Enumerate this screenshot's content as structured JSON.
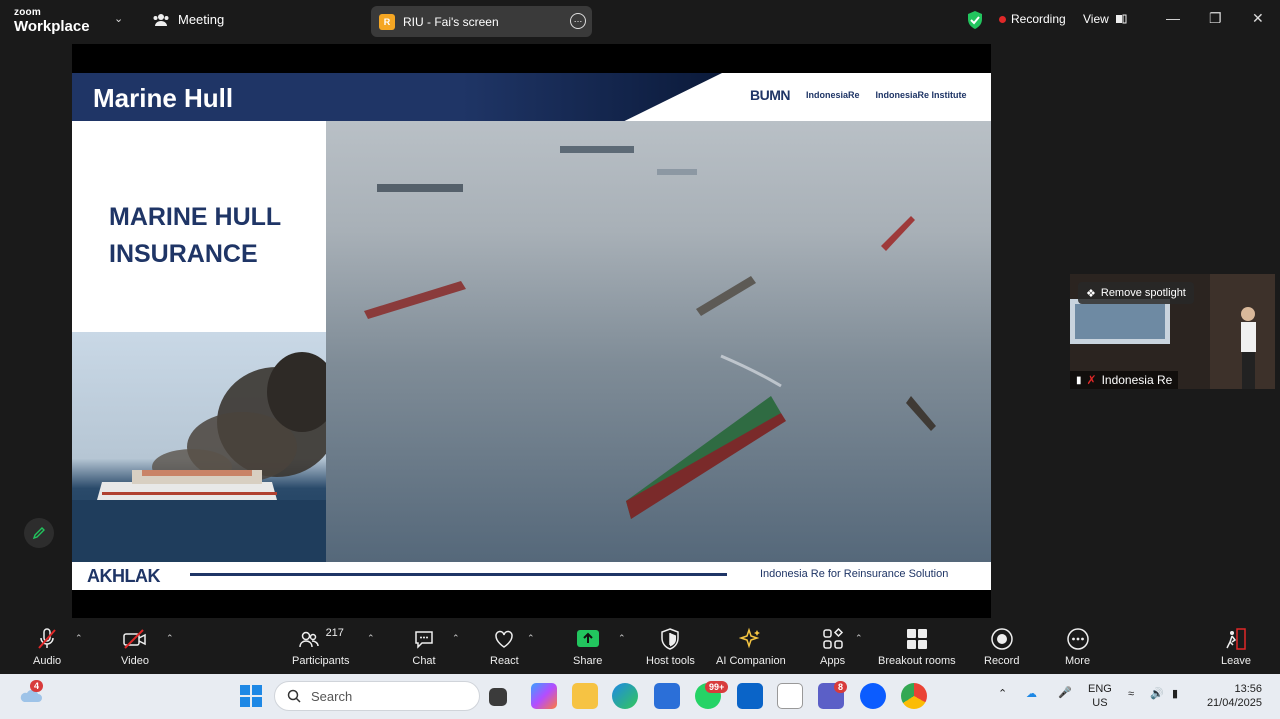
{
  "app": {
    "logo_top": "zoom",
    "logo_bottom": "Workplace",
    "meeting_label": "Meeting"
  },
  "screen_share": {
    "badge": "R",
    "label": "RIU - Fai's screen"
  },
  "status": {
    "recording_label": "Recording",
    "view_label": "View"
  },
  "slide": {
    "header_title": "Marine Hull",
    "partners": [
      "BUMN",
      "IndonesiaRe",
      "IndonesiaRe Institute"
    ],
    "left_title": "MARINE HULL\nINSURANCE",
    "footer_logo": "AKHLAK",
    "footer_text": "Indonesia Re for Reinsurance Solution"
  },
  "spotlight": {
    "remove_label": "Remove spotlight",
    "participant_name": "Indonesia Re"
  },
  "toolbar": {
    "audio": "Audio",
    "video": "Video",
    "participants": "Participants",
    "participants_count": "217",
    "chat": "Chat",
    "react": "React",
    "share": "Share",
    "host_tools": "Host tools",
    "ai_companion": "AI Companion",
    "apps": "Apps",
    "breakout_rooms": "Breakout rooms",
    "record": "Record",
    "more": "More",
    "leave": "Leave"
  },
  "taskbar": {
    "weather_badge": "4",
    "search_placeholder": "Search",
    "whatsapp_badge": "99+",
    "teams_badge": "8",
    "lang_top": "ENG",
    "lang_bottom": "US",
    "time": "13:56",
    "date": "21/04/2025"
  },
  "colors": {
    "brand_navy": "#1f3566",
    "share_green": "#22c55e",
    "record_red": "#e02828"
  }
}
